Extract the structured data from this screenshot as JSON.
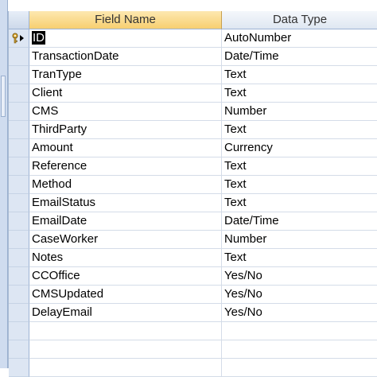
{
  "columns": {
    "field_name": "Field Name",
    "data_type": "Data Type"
  },
  "rows": [
    {
      "field": "ID",
      "type": "AutoNumber"
    },
    {
      "field": "TransactionDate",
      "type": "Date/Time"
    },
    {
      "field": "TranType",
      "type": "Text"
    },
    {
      "field": "Client",
      "type": "Text"
    },
    {
      "field": "CMS",
      "type": "Number"
    },
    {
      "field": "ThirdParty",
      "type": "Text"
    },
    {
      "field": "Amount",
      "type": "Currency"
    },
    {
      "field": "Reference",
      "type": "Text"
    },
    {
      "field": "Method",
      "type": "Text"
    },
    {
      "field": "EmailStatus",
      "type": "Text"
    },
    {
      "field": "EmailDate",
      "type": "Date/Time"
    },
    {
      "field": "CaseWorker",
      "type": "Number"
    },
    {
      "field": "Notes",
      "type": "Text"
    },
    {
      "field": "CCOffice",
      "type": "Yes/No"
    },
    {
      "field": "CMSUpdated",
      "type": "Yes/No"
    },
    {
      "field": "DelayEmail",
      "type": "Yes/No"
    },
    {
      "field": "",
      "type": ""
    },
    {
      "field": "",
      "type": ""
    },
    {
      "field": "",
      "type": ""
    }
  ],
  "icons": {
    "primary_key_row": "key-current-row-icon"
  },
  "colors": {
    "field_header": "#f7cf70",
    "selection": "#000000"
  }
}
